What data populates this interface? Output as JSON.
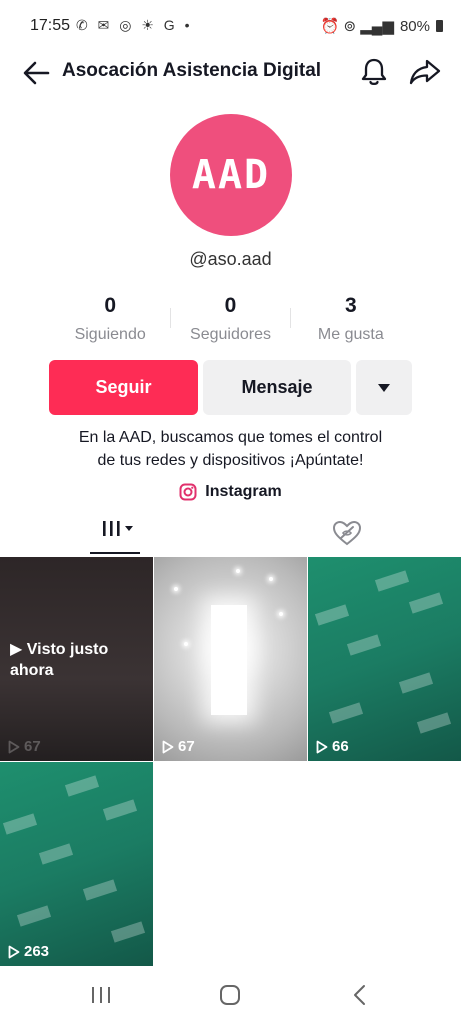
{
  "status_bar": {
    "time": "17:55",
    "notification_icons": [
      "whatsapp-icon",
      "message-icon",
      "instagram-icon",
      "weather-icon",
      "google-icon",
      "dot-icon"
    ],
    "notification_glyphs": "✆ ✉ ◎ ☀ G •",
    "right_glyphs": "⏰ ⊚ ▂▄▆",
    "battery": "80%"
  },
  "header": {
    "title": "Asocación Asistencia Digital"
  },
  "profile": {
    "avatar_text": "AAD",
    "avatar_color": "#ef4f7d",
    "username": "@aso.aad"
  },
  "stats": [
    {
      "value": "0",
      "label": "Siguiendo"
    },
    {
      "value": "0",
      "label": "Seguidores"
    },
    {
      "value": "3",
      "label": "Me gusta"
    }
  ],
  "actions": {
    "follow": "Seguir",
    "message": "Mensaje",
    "follow_color": "#fe2c55"
  },
  "bio": {
    "line1": "En la AAD, buscamos que tomes el control",
    "line2": "de tus redes y dispositivos ¡Apúntate!"
  },
  "link": {
    "label": "Instagram"
  },
  "videos": [
    {
      "views": "67",
      "overlay": "▶ Visto justo ahora"
    },
    {
      "views": "67"
    },
    {
      "views": "66"
    },
    {
      "views": "263"
    }
  ]
}
